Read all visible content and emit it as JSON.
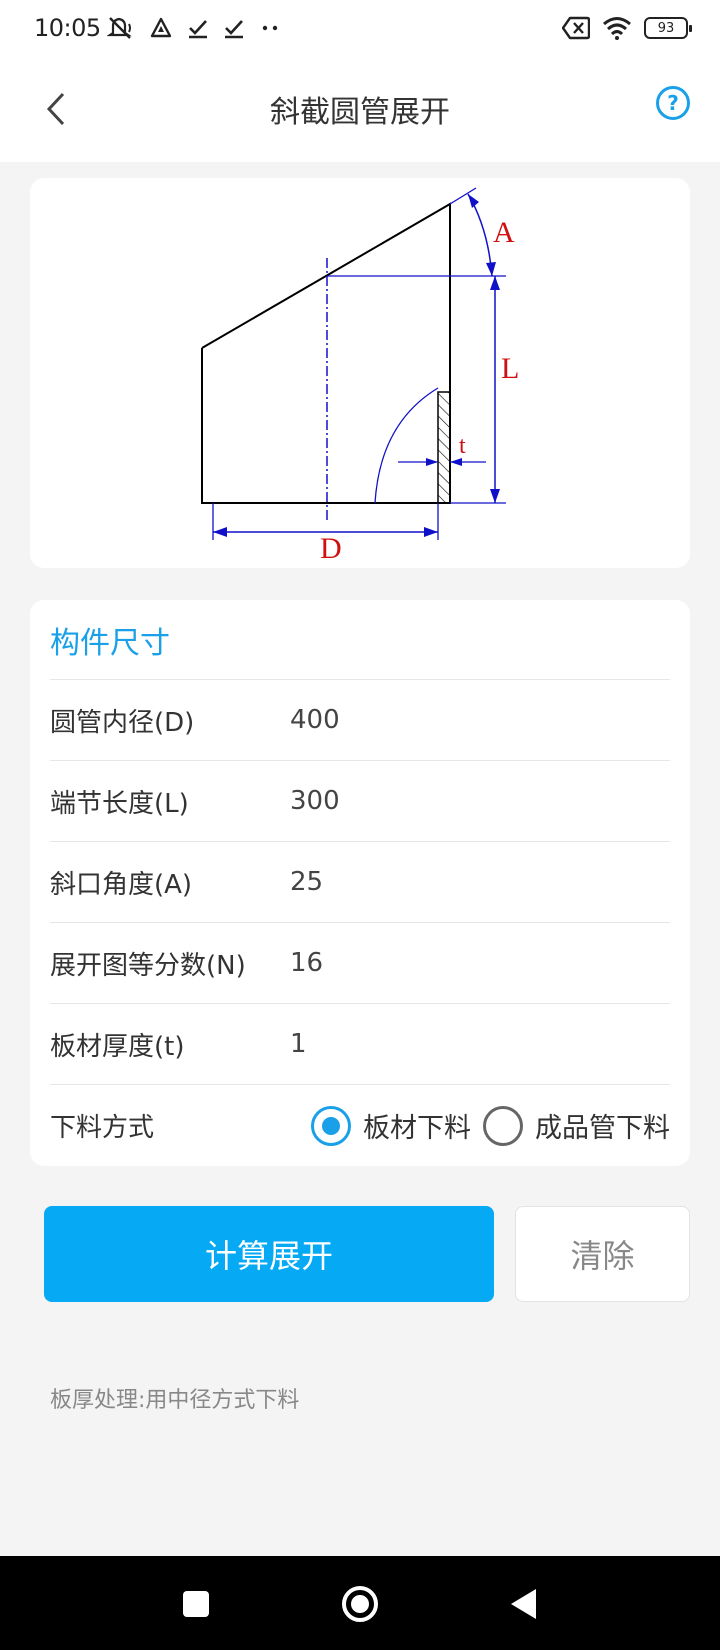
{
  "status_bar": {
    "time": "10:05",
    "left_icons": [
      "mute-icon",
      "navigation-icon",
      "check-icon",
      "check-icon",
      "more-dots-icon"
    ],
    "right_icons": [
      "no-sim-icon",
      "wifi-icon",
      "battery-icon"
    ],
    "battery_level": "93"
  },
  "app_bar": {
    "title": "斜截圆管展开",
    "back_icon": "chevron-left-icon",
    "help_icon": "help-icon",
    "help_glyph": "?"
  },
  "diagram": {
    "label_a": "A",
    "label_l": "L",
    "label_t": "t",
    "label_d": "D",
    "line_color": "#000000",
    "dimension_color": "#1010c8",
    "label_color": "#d01010"
  },
  "form": {
    "section_title": "构件尺寸",
    "fields": [
      {
        "label": "圆管内径(D)",
        "value": "400"
      },
      {
        "label": "端节长度(L)",
        "value": "300"
      },
      {
        "label": "斜口角度(A)",
        "value": "25"
      },
      {
        "label": "展开图等分数(N)",
        "value": "16"
      },
      {
        "label": "板材厚度(t)",
        "value": "1"
      }
    ],
    "method_label": "下料方式",
    "method_options": [
      {
        "label": "板材下料",
        "checked": true
      },
      {
        "label": "成品管下料",
        "checked": false
      }
    ]
  },
  "actions": {
    "calculate_label": "计算展开",
    "clear_label": "清除"
  },
  "note": "板厚处理:用中径方式下料",
  "colors": {
    "accent": "#1aa0e8",
    "primary_button": "#06a9f4",
    "background": "#f4f4f4"
  },
  "nav_bar": {
    "icons": [
      "recents-square-icon",
      "home-circle-icon",
      "back-triangle-icon"
    ]
  }
}
